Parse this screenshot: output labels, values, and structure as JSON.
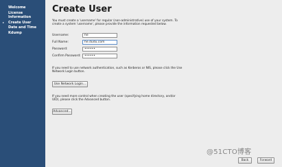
{
  "sidebar": {
    "steps": [
      {
        "label": "Welcome",
        "marker": ""
      },
      {
        "label": "License Information",
        "marker": ""
      },
      {
        "label": "Create User",
        "marker": "▸"
      },
      {
        "label": "Date and Time",
        "marker": ""
      },
      {
        "label": "Kdump",
        "marker": ""
      }
    ]
  },
  "page": {
    "title": "Create User",
    "intro": "You must create a 'username' for regular (non-administrative) use of your system. To create a system 'username', please provide the information requested below."
  },
  "form": {
    "username": {
      "label": "Username:",
      "value": "he"
    },
    "full_name": {
      "label": "Full Name:",
      "value": "he.dudu.com"
    },
    "password": {
      "label": "Password:",
      "value": "••••••"
    },
    "confirm_password": {
      "label": "Confirm Password:",
      "value": "••••••"
    }
  },
  "network": {
    "text": "If you need to use network authentication, such as Kerberos or NIS, please click the Use Network Login button.",
    "button_label": "Use Network Login..."
  },
  "advanced": {
    "text": "If you need more control when creating the user (specifying home directory, and/or UID), please click the Advanced button.",
    "button_label": "Advanced..."
  },
  "navigation": {
    "back_label": "Back",
    "forward_label": "Forward"
  },
  "watermark": {
    "text": "@51CTO博客"
  },
  "colors": {
    "sidebar_bg": "#2a4e78",
    "content_bg": "#ededed"
  }
}
